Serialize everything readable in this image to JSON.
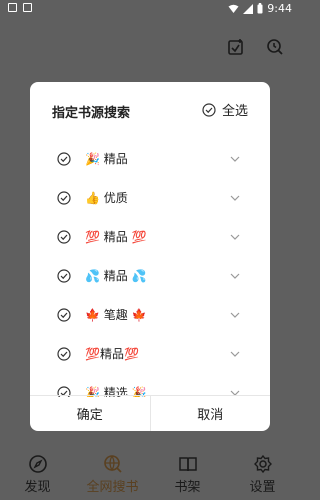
{
  "status": {
    "time": "9:44"
  },
  "dialog": {
    "title": "指定书源搜索",
    "select_all": "全选",
    "rows": [
      {
        "label": "🎉 精品"
      },
      {
        "label": "👍 优质"
      },
      {
        "label": "💯 精品 💯"
      },
      {
        "label": "💦 精品 💦"
      },
      {
        "label": "🍁 笔趣 🍁"
      },
      {
        "label": "💯精品💯"
      },
      {
        "label": "🎉 精选 🎉"
      }
    ],
    "confirm": "确定",
    "cancel": "取消"
  },
  "bottom_nav": [
    {
      "label": "发现"
    },
    {
      "label": "全网搜书"
    },
    {
      "label": "书架"
    },
    {
      "label": "设置"
    }
  ]
}
